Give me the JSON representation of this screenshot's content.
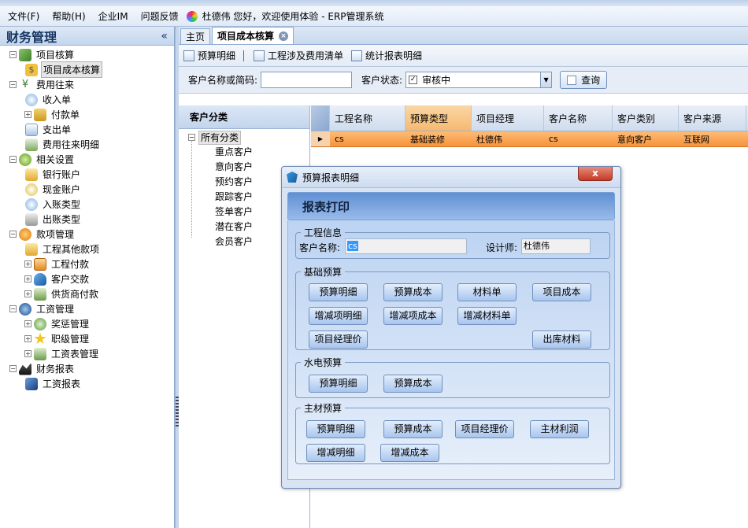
{
  "menu": {
    "items": [
      "文件(F)",
      "帮助(H)",
      "企业IM",
      "问题反馈"
    ],
    "welcome": "杜德伟 您好，欢迎使用体验 - ERP管理系统"
  },
  "sidebar": {
    "title": "财务管理",
    "collapse": "«",
    "tree": [
      {
        "label": "项目核算",
        "children": [
          "项目成本核算"
        ]
      },
      {
        "label": "费用往来",
        "children": [
          "收入单",
          "付款单",
          "支出单",
          "费用往来明细"
        ]
      },
      {
        "label": "相关设置",
        "children": [
          "银行账户",
          "现金账户",
          "入账类型",
          "出账类型"
        ]
      },
      {
        "label": "款项管理",
        "children": [
          "工程其他款项",
          "工程付款",
          "客户交款",
          "供货商付款"
        ]
      },
      {
        "label": "工资管理",
        "children": [
          "奖惩管理",
          "职级管理",
          "工资表管理"
        ]
      },
      {
        "label": "财务报表",
        "children": [
          "工资报表"
        ]
      }
    ]
  },
  "tabs": {
    "home": "主页",
    "active": "项目成本核算",
    "close": "×"
  },
  "toolbar": {
    "budget_detail": "预算明细",
    "project_fee_list": "工程涉及费用清单",
    "stats_detail": "统计报表明细"
  },
  "filter": {
    "customer_label": "客户名称或简码:",
    "customer_value": "",
    "status_label": "客户状态:",
    "status_value": "审核中",
    "query_button": "查询"
  },
  "category": {
    "title": "客户分类",
    "root": "所有分类",
    "items": [
      "重点客户",
      "意向客户",
      "预约客户",
      "跟踪客户",
      "签单客户",
      "潜在客户",
      "会员客户"
    ]
  },
  "grid": {
    "columns": [
      "工程名称",
      "预算类型",
      "项目经理",
      "客户名称",
      "客户类别",
      "客户来源"
    ],
    "rows": [
      [
        "cs",
        "基础装修",
        "杜德伟",
        "cs",
        "意向客户",
        "互联网"
      ]
    ]
  },
  "dialog": {
    "title": "预算报表明细",
    "close": "x",
    "heading": "报表打印",
    "project_info": {
      "legend": "工程信息",
      "customer_label": "客户名称:",
      "customer_value": "cs",
      "designer_label": "设计师:",
      "designer_value": "杜德伟"
    },
    "basic": {
      "legend": "基础预算",
      "buttons": [
        "预算明细",
        "预算成本",
        "材料单",
        "项目成本",
        "增减项明细",
        "增减项成本",
        "增减材料单",
        "项目经理价",
        "出库材料"
      ]
    },
    "hydro": {
      "legend": "水电预算",
      "buttons": [
        "预算明细",
        "预算成本"
      ]
    },
    "main_material": {
      "legend": "主材预算",
      "buttons": [
        "预算明细",
        "预算成本",
        "项目经理价",
        "主材利润",
        "增减明细",
        "增减成本"
      ]
    }
  },
  "colors": {
    "accent_orange": "#f7923a",
    "header_blue": "#c4d6ee",
    "dialog_blue": "#5f8fd3"
  }
}
